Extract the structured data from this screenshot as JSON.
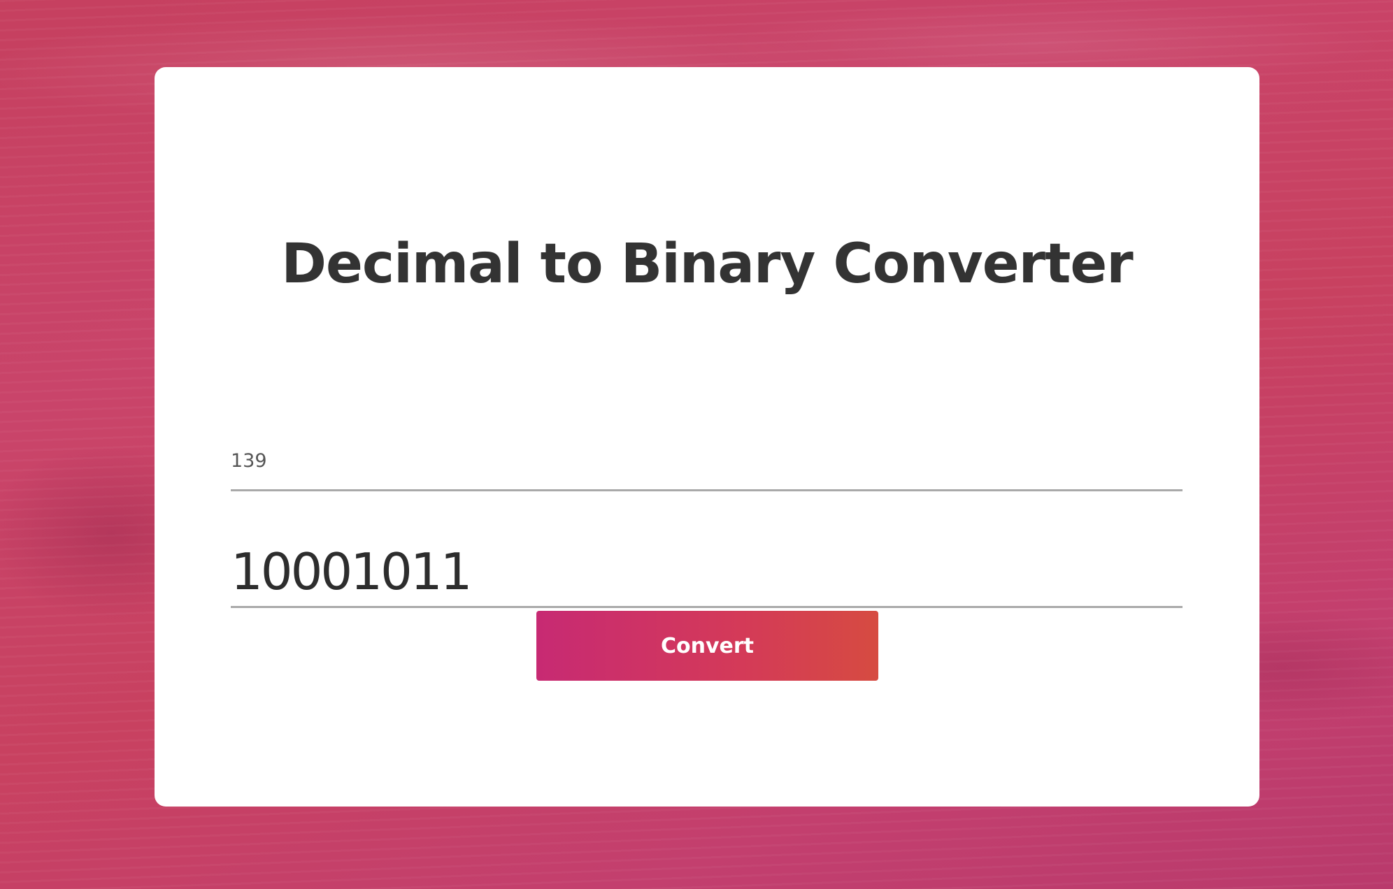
{
  "page": {
    "title": "Decimal to Binary Converter"
  },
  "converter": {
    "decimal_value": "139",
    "binary_result": "10001011",
    "convert_label": "Convert"
  },
  "colors": {
    "background_accent": "#c6405f",
    "title_text": "#333333",
    "button_gradient_start": "#c72a73",
    "button_gradient_end": "#d64b41",
    "underline": "#a9a9a9"
  }
}
